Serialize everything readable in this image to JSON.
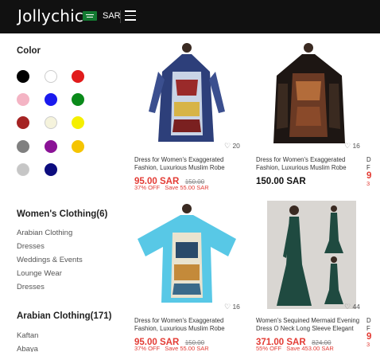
{
  "header": {
    "logo": "Jollychic",
    "currency": "SAR"
  },
  "sidebar": {
    "color_title": "Color",
    "colors": [
      "#000000",
      "#ffffff",
      "#e11b1b",
      "#f4b4c4",
      "#1a1aee",
      "#0a8a1a",
      "#a52323",
      "#f5f3dc",
      "#f5ef00",
      "#808080",
      "#8a1296",
      "#f5c400",
      "#c6c6c6",
      "#0c0c7e"
    ],
    "womens_title": "Women's Clothing(6)",
    "womens_items": [
      "Arabian Clothing",
      "Dresses",
      "Weddings & Events",
      "Lounge Wear",
      "Dresses"
    ],
    "arabian_title": "Arabian Clothing(171)",
    "arabian_items": [
      "Kaftan",
      "Abaya"
    ]
  },
  "products": [
    {
      "name1": "Dress for Women's Exaggerated",
      "name2": "Fashion, Luxurious Muslim Robe",
      "price": "95.00 SAR",
      "old_price": "150.00",
      "off": "37% OFF",
      "save": "Save 55.00 SAR",
      "likes": "20"
    },
    {
      "name1": "Dress for Women's Exaggerated",
      "name2": "Fashion, Luxurious Muslim Robe",
      "price": "150.00 SAR",
      "likes": "16"
    },
    {
      "name1": "Dress for Women's Exaggerated",
      "name2": "Fashion, Luxurious Muslim Robe",
      "price": "95.00 SAR",
      "old_price": "150.00",
      "off": "37% OFF",
      "save": "Save 55.00 SAR",
      "likes": "16"
    },
    {
      "name1": "Women's Sequined Mermaid Evening",
      "name2": "Dress O Neck Long Sleeve Elegant",
      "price": "371.00 SAR",
      "old_price": "824.00",
      "off": "55% OFF",
      "save": "Save 453.00 SAR",
      "likes": "44"
    }
  ],
  "partial": {
    "top_lines": [
      "D",
      "F",
      "9",
      "3"
    ],
    "bottom_lines": [
      "D",
      "F",
      "9",
      "3"
    ]
  }
}
